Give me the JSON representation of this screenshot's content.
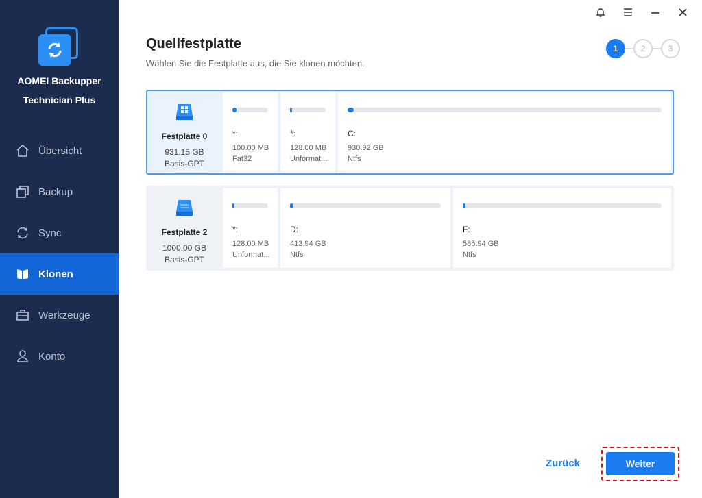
{
  "app": {
    "name_line1": "AOMEI Backupper",
    "name_line2": "Technician Plus"
  },
  "sidebar": {
    "items": [
      {
        "label": "Übersicht",
        "icon": "home-icon"
      },
      {
        "label": "Backup",
        "icon": "backup-icon"
      },
      {
        "label": "Sync",
        "icon": "sync-icon"
      },
      {
        "label": "Klonen",
        "icon": "clone-icon",
        "active": true
      },
      {
        "label": "Werkzeuge",
        "icon": "toolbox-icon"
      },
      {
        "label": "Konto",
        "icon": "user-icon"
      }
    ]
  },
  "window_controls": [
    "bell-icon",
    "menu-icon",
    "minimize-icon",
    "close-icon"
  ],
  "header": {
    "title": "Quellfestplatte",
    "subtitle": "Wählen Sie die Festplatte aus, die Sie klonen möchten."
  },
  "steps": [
    "1",
    "2",
    "3"
  ],
  "active_step": 1,
  "disks": [
    {
      "name": "Festplatte 0",
      "size": "931.15 GB",
      "type": "Basis-GPT",
      "selected": true,
      "partitions": [
        {
          "label": "*:",
          "size": "100.00 MB",
          "fs": "Fat32",
          "used_fraction": 0.12
        },
        {
          "label": "*:",
          "size": "128.00 MB",
          "fs": "Unformat...",
          "used_fraction": 0.05
        },
        {
          "label": "C:",
          "size": "930.92 GB",
          "fs": "Ntfs",
          "used_fraction": 0.02
        }
      ]
    },
    {
      "name": "Festplatte 2",
      "size": "1000.00 GB",
      "type": "Basis-GPT",
      "selected": false,
      "partitions": [
        {
          "label": "*:",
          "size": "128.00 MB",
          "fs": "Unformat...",
          "used_fraction": 0.05
        },
        {
          "label": "D:",
          "size": "413.94 GB",
          "fs": "Ntfs",
          "used_fraction": 0.02
        },
        {
          "label": "F:",
          "size": "585.94 GB",
          "fs": "Ntfs",
          "used_fraction": 0.015
        }
      ]
    }
  ],
  "footer": {
    "back_label": "Zurück",
    "next_label": "Weiter"
  },
  "colors": {
    "sidebar_bg": "#1c2c4e",
    "accent": "#1a7cf0",
    "highlight_border": "#e0101a"
  }
}
